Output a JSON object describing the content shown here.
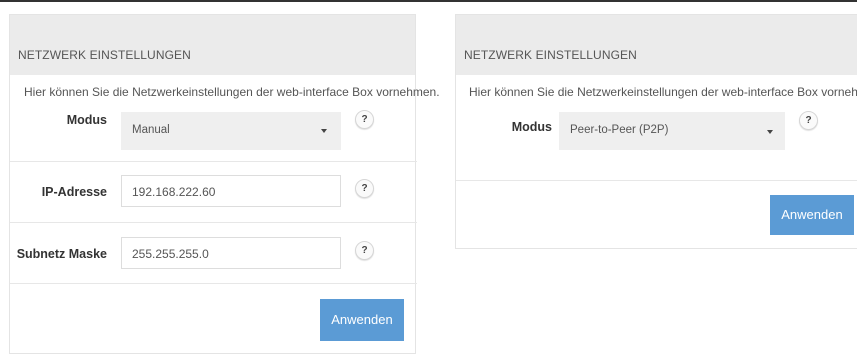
{
  "left_panel": {
    "title": "NETZWERK EINSTELLUNGEN",
    "intro": "Hier können Sie die Netzwerkeinstellungen der web-interface Box vornehmen.",
    "mode_label": "Modus",
    "mode_value": "Manual",
    "ip_label": "IP-Adresse",
    "ip_value": "192.168.222.60",
    "subnet_label": "Subnetz Maske",
    "subnet_value": "255.255.255.0",
    "help_symbol": "?",
    "apply_label": "Anwenden"
  },
  "right_panel": {
    "title": "NETZWERK EINSTELLUNGEN",
    "intro": "Hier können Sie die Netzwerkeinstellungen der web-interface Box vornehmen.",
    "mode_label": "Modus",
    "mode_value": "Peer-to-Peer (P2P)",
    "help_symbol": "?",
    "apply_label": "Anwenden"
  }
}
